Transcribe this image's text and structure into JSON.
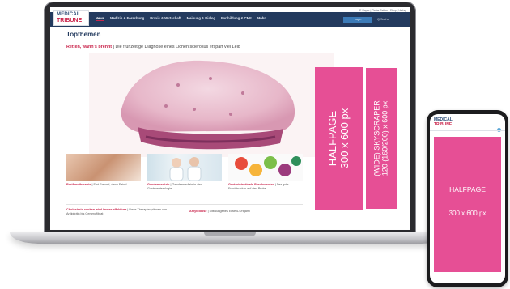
{
  "site": {
    "logo_line1": "MEDICAL",
    "logo_line2": "TRIBUNE",
    "util_links": "E-Paper | Gelbe Seiten | Shop | Verlag",
    "nav": [
      "News",
      "Medizin & Forschung",
      "Praxis & Wirtschaft",
      "Meinung & Dialog",
      "Fortbildung & CME",
      "Mehr"
    ],
    "login": "Login",
    "search": "Q Suche"
  },
  "content": {
    "section_title": "Topthemen",
    "headline_red": "Retten, wann's brennt",
    "headline_rest": " | Die frühzeitige Diagnose eines Lichen sclerosus erspart viel Leid",
    "teasers": [
      {
        "bold": "Rorifanotherapie",
        "text": " | Erst Freund, dann Feind"
      },
      {
        "bold": "Gendermedizin",
        "text": " | Gendermedizin in der Gastroenterologie"
      },
      {
        "bold": "Gastrointestinale Beschwerden",
        "text": " | Der gute Fruchtzucker auf den Probe"
      }
    ],
    "story1_bold": "Cholesterin senken wird immer effektiver",
    "story1_text": " | Neue Therapieoptionen von Antigliptin bis Gemmofibrat",
    "story2_bold": "Amyloidose",
    "story2_text": " | Misslungenes Eiweiß-Origami"
  },
  "ads": {
    "halfpage_line1": "HALFPAGE",
    "halfpage_line2": "300 x 600 px",
    "sky_line1": "(WIDE) SKYSCRAPER",
    "sky_line2": "120 (160/200) x 600 px",
    "mobile_line1": "HALFPAGE",
    "mobile_line2": "300 x 600 px",
    "color": "#e64f95"
  }
}
